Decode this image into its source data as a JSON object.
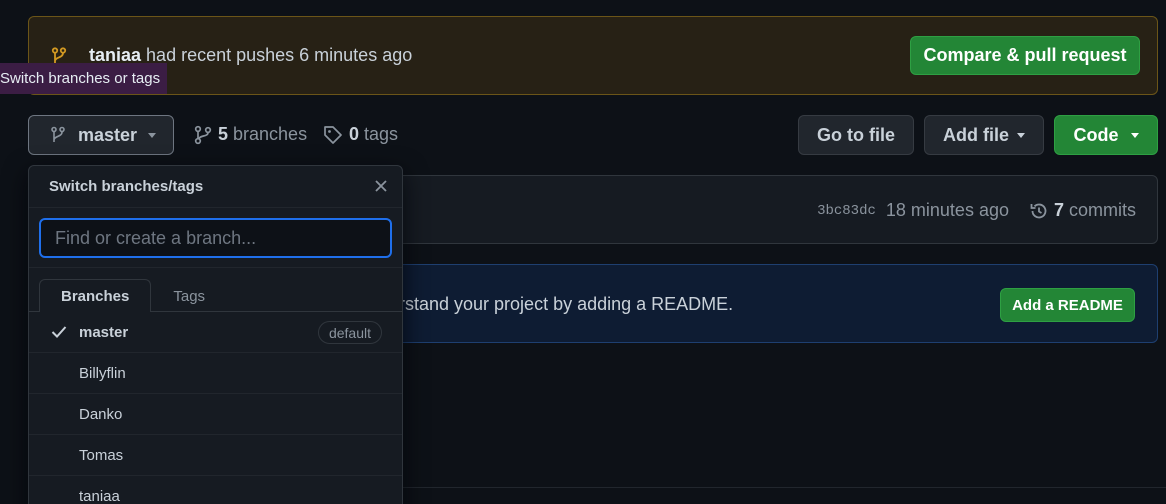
{
  "push_banner": {
    "user": "taniaa",
    "message": "had recent pushes 6 minutes ago",
    "compare_label": "Compare & pull request"
  },
  "tooltip": {
    "text": "Switch branches or tags"
  },
  "toolbar": {
    "current_branch": "master",
    "branch_count": "5",
    "branch_label": "branches",
    "tag_count": "0",
    "tag_label": "tags",
    "go_to_file": "Go to file",
    "add_file": "Add file",
    "code": "Code"
  },
  "commit": {
    "sha": "3bc83dc",
    "age": "18 minutes ago",
    "commit_count": "7",
    "commit_label": "commits"
  },
  "readme": {
    "text": "rstand your project by adding a README.",
    "button": "Add a README"
  },
  "dropdown": {
    "title": "Switch branches/tags",
    "search_placeholder": "Find or create a branch...",
    "tabs": [
      "Branches",
      "Tags"
    ],
    "default_badge": "default",
    "branches": [
      "master",
      "Billyflin",
      "Danko",
      "Tomas",
      "taniaa"
    ]
  },
  "colors": {
    "accent_green": "#238636",
    "focus_blue": "#1f6feb",
    "warning_icon": "#d29922"
  }
}
